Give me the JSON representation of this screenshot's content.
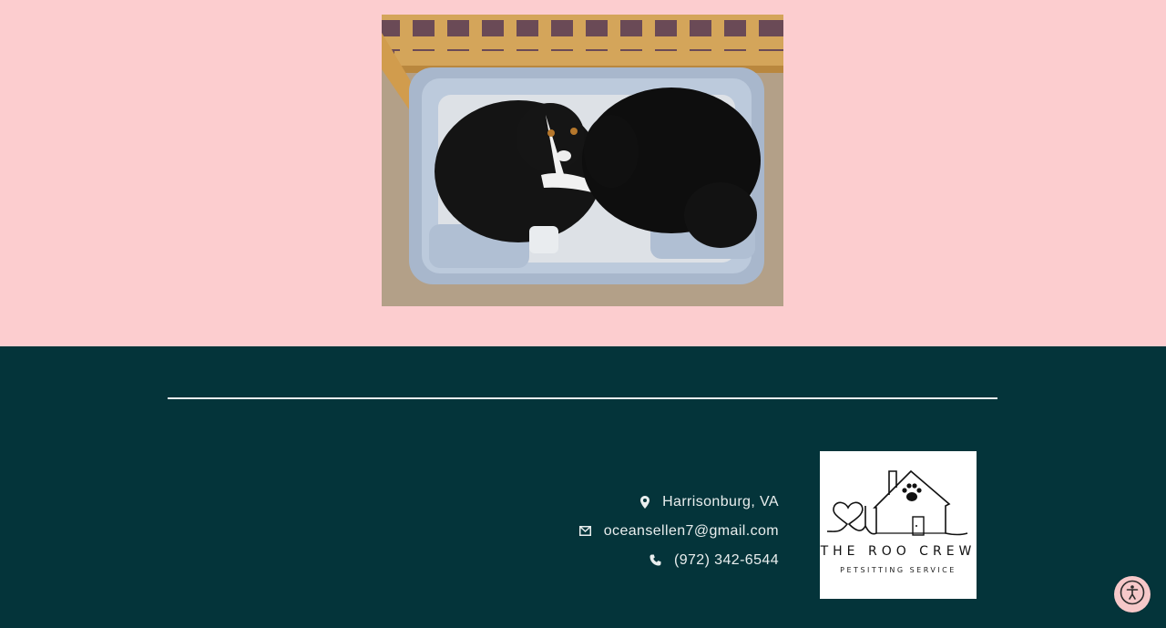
{
  "photo": {
    "alt_subject": "dogs-on-bed"
  },
  "footer": {
    "contact": [
      {
        "icon": "map-pin-icon",
        "text": "Harrisonburg, VA"
      },
      {
        "icon": "envelope-icon",
        "text": "oceansellen7@gmail.com"
      },
      {
        "icon": "phone-icon",
        "text": "(972) 342-6544"
      }
    ],
    "logo": {
      "title": "THE ROO CREW",
      "subtitle": "PETSITTING SERVICE"
    }
  },
  "accessibility": {
    "icon": "accessibility-icon"
  },
  "colors": {
    "page_background": "#fccdcf",
    "footer_background": "#04343a",
    "footer_text": "#e9eeee",
    "accessibility_button": "#f6c8c9"
  }
}
